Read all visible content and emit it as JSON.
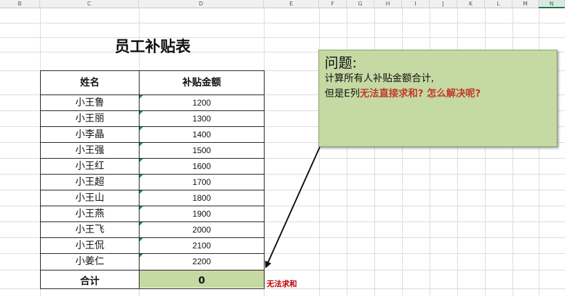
{
  "columns": [
    "B",
    "C",
    "D",
    "E",
    "F",
    "G",
    "H",
    "I",
    "J",
    "K",
    "L",
    "M",
    "N"
  ],
  "title": "员工补贴表",
  "table": {
    "header_name": "姓名",
    "header_amount": "补贴金额",
    "rows": [
      {
        "name": "小王鲁",
        "amount": "1200"
      },
      {
        "name": "小王丽",
        "amount": "1300"
      },
      {
        "name": "小李晶",
        "amount": "1400"
      },
      {
        "name": "小王强",
        "amount": "1500"
      },
      {
        "name": "小王红",
        "amount": "1600"
      },
      {
        "name": "小王超",
        "amount": "1700"
      },
      {
        "name": "小王山",
        "amount": "1800"
      },
      {
        "name": "小王燕",
        "amount": "1900"
      },
      {
        "name": "小王飞",
        "amount": "2000"
      },
      {
        "name": "小王侃",
        "amount": "2100"
      },
      {
        "name": "小姜仁",
        "amount": "2200"
      }
    ],
    "total_label": "合计",
    "total_value": "0"
  },
  "note": {
    "title": "问题:",
    "line1": "计算所有人补贴金额合计,",
    "line2_prefix": "但是E列",
    "line2_highlight": "无法直接求和? 怎么解决呢?"
  },
  "side_label": "无法求和",
  "colors": {
    "note_fill": "#c5d9a2",
    "highlight_red": "#c0392b",
    "error_indicator": "#2e8b2e"
  }
}
